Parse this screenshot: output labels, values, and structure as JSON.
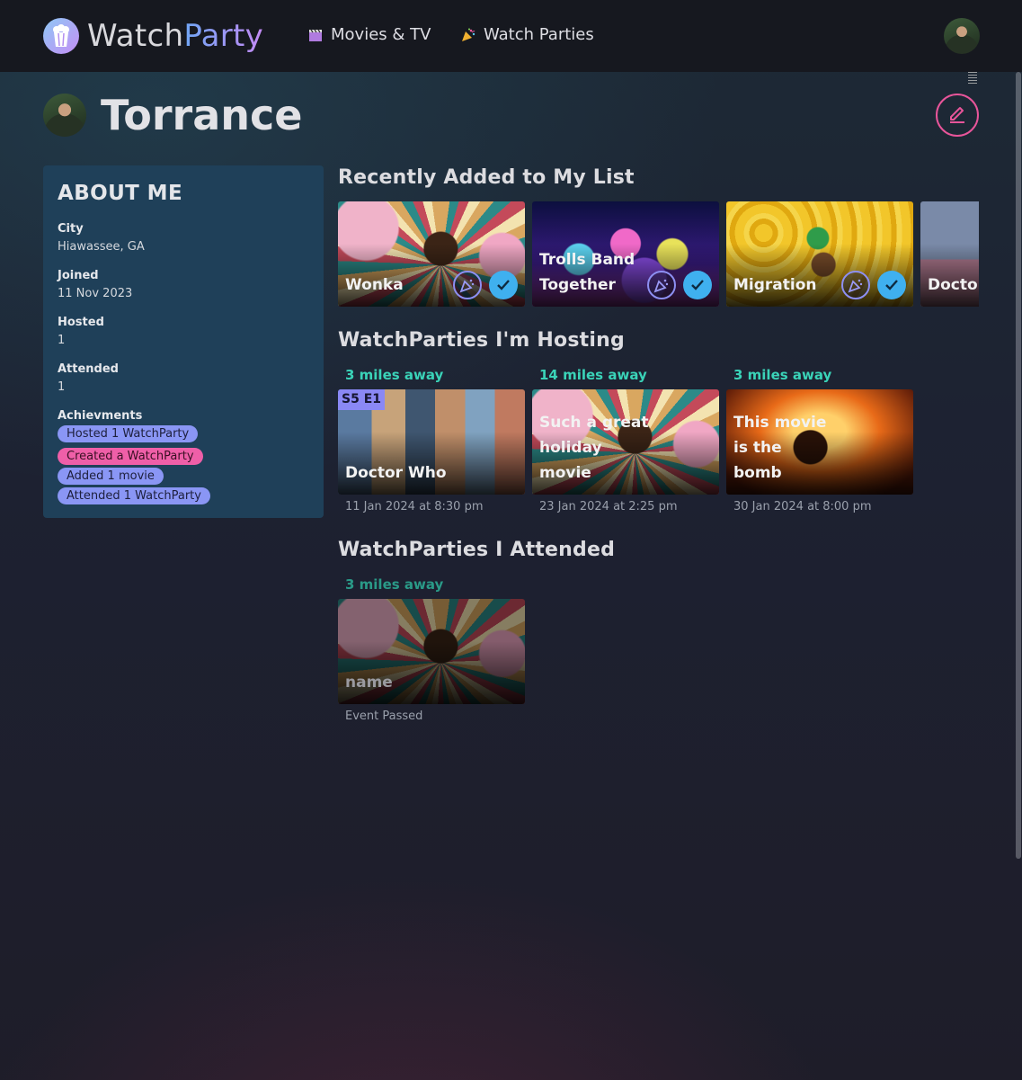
{
  "app": {
    "logo_word1": "Watch",
    "logo_word2": "Party"
  },
  "nav": {
    "movies_tv": "Movies & TV",
    "watch_parties": "Watch Parties"
  },
  "profile": {
    "name": "Torrance"
  },
  "about": {
    "heading": "ABOUT ME",
    "city_label": "City",
    "city": "Hiawassee, GA",
    "joined_label": "Joined",
    "joined": "11 Nov 2023",
    "hosted_label": "Hosted",
    "hosted": "1",
    "attended_label": "Attended",
    "attended": "1",
    "achievements_label": "Achievments",
    "achievements": [
      "Hosted 1 WatchParty",
      "Created a WatchParty",
      "Added 1 movie",
      "Attended 1 WatchParty"
    ]
  },
  "recent": {
    "title": "Recently Added to My List",
    "items": [
      {
        "title": "Wonka"
      },
      {
        "title": "Trolls Band Together"
      },
      {
        "title": "Migration"
      },
      {
        "title": "Doctor"
      }
    ]
  },
  "hosting": {
    "title": "WatchParties I'm Hosting",
    "items": [
      {
        "distance": "3 miles away",
        "badge": "S5 E1",
        "title": "Doctor Who",
        "datetime": "11 Jan 2024 at 8:30 pm"
      },
      {
        "distance": "14 miles away",
        "title": "Such a great holiday movie",
        "datetime": "23 Jan 2024 at 2:25 pm"
      },
      {
        "distance": "3 miles away",
        "title": "This movie is the bomb",
        "datetime": "30 Jan 2024 at 8:00 pm"
      }
    ]
  },
  "attended": {
    "title": "WatchParties I Attended",
    "items": [
      {
        "distance": "3 miles away",
        "title": "name",
        "status": "Event Passed"
      }
    ]
  },
  "colors": {
    "accent_pink": "#e8559a",
    "accent_teal": "#3ad3b8",
    "badge_blue": "#8a96f5",
    "check_blue": "#3fb0ef"
  }
}
